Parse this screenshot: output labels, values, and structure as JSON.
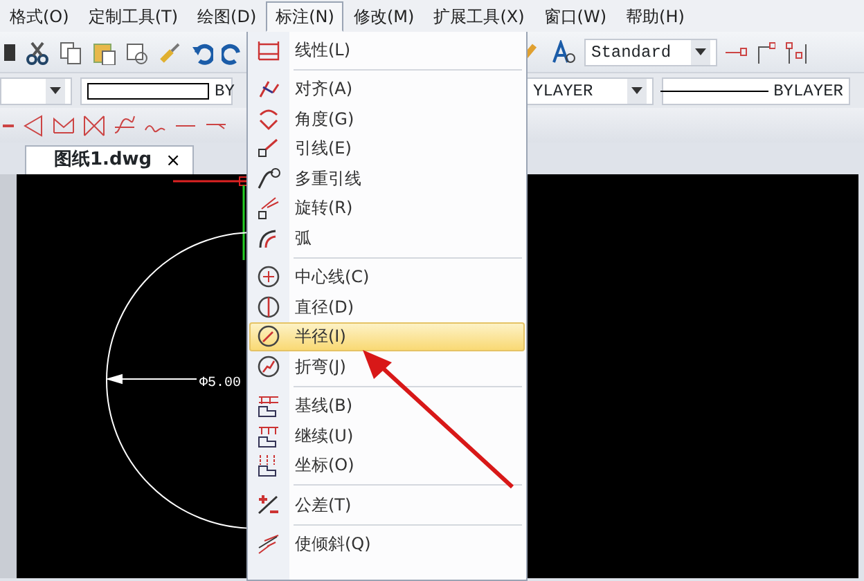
{
  "menu_bar": [
    {
      "label": "格式(O)",
      "selected": false
    },
    {
      "label": "定制工具(T)",
      "selected": false
    },
    {
      "label": "绘图(D)",
      "selected": false
    },
    {
      "label": "标注(N)",
      "selected": true
    },
    {
      "label": "修改(M)",
      "selected": false
    },
    {
      "label": "扩展工具(X)",
      "selected": false
    },
    {
      "label": "窗口(W)",
      "selected": false
    },
    {
      "label": "帮助(H)",
      "selected": false
    }
  ],
  "toolbar": {
    "text_style": "Standard"
  },
  "properties_bar": {
    "color_value": "BY",
    "linetype": "YLAYER",
    "lineweight": "BYLAYER"
  },
  "tabs": [
    {
      "label": "图纸1.dwg",
      "close": "×",
      "selected": true
    }
  ],
  "drawing": {
    "dimension_text": "Φ5.00"
  },
  "dropdown": {
    "items": [
      {
        "kind": "item",
        "label": "线性(L)",
        "selected": false
      },
      {
        "kind": "separator"
      },
      {
        "kind": "item",
        "label": "对齐(A)",
        "selected": false
      },
      {
        "kind": "item",
        "label": "角度(G)",
        "selected": false
      },
      {
        "kind": "item",
        "label": "引线(E)",
        "selected": false
      },
      {
        "kind": "item",
        "label": "多重引线",
        "selected": false
      },
      {
        "kind": "item",
        "label": "旋转(R)",
        "selected": false
      },
      {
        "kind": "item",
        "label": "弧",
        "selected": false
      },
      {
        "kind": "separator"
      },
      {
        "kind": "item",
        "label": "中心线(C)",
        "selected": false
      },
      {
        "kind": "item",
        "label": "直径(D)",
        "selected": false
      },
      {
        "kind": "item",
        "label": "半径(I)",
        "selected": true
      },
      {
        "kind": "item",
        "label": "折弯(J)",
        "selected": false
      },
      {
        "kind": "separator"
      },
      {
        "kind": "item",
        "label": "基线(B)",
        "selected": false
      },
      {
        "kind": "item",
        "label": "继续(U)",
        "selected": false
      },
      {
        "kind": "item",
        "label": "坐标(O)",
        "selected": false
      },
      {
        "kind": "separator"
      },
      {
        "kind": "item",
        "label": "公差(T)",
        "selected": false
      },
      {
        "kind": "separator"
      },
      {
        "kind": "item",
        "label": "使倾斜(Q)",
        "selected": false
      }
    ]
  }
}
